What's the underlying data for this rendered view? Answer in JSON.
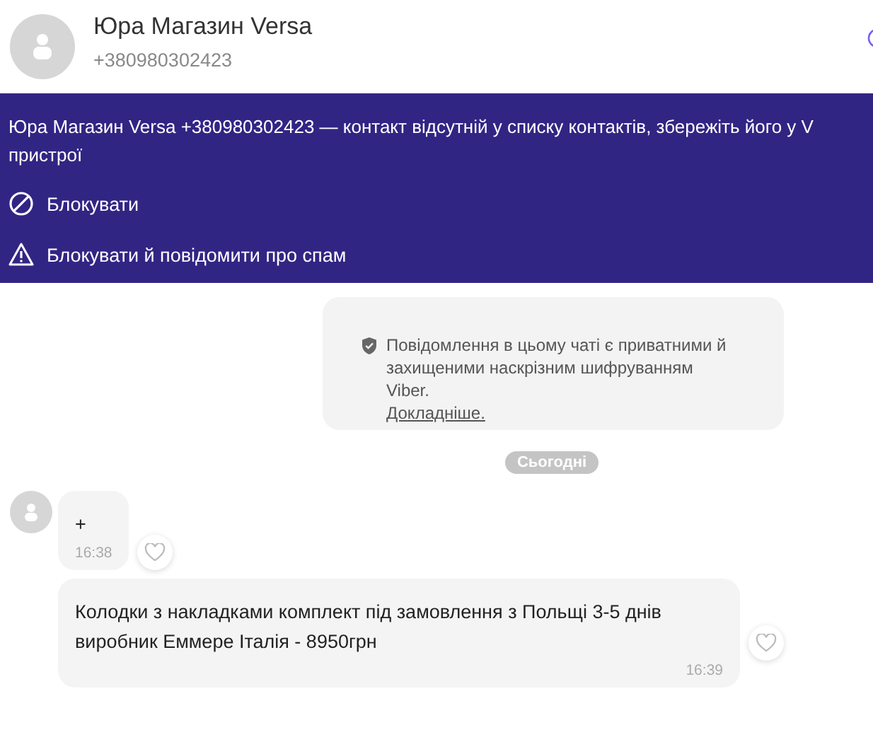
{
  "header": {
    "name": "Юра Магазин Versa",
    "phone": "+380980302423"
  },
  "banner": {
    "lines": [
      "Юра Магазин Versa +380980302423 — контакт відсутній у списку контактів, збережіть його у V",
      "пристрої"
    ],
    "actions": [
      {
        "kind": "block",
        "label": "Блокувати"
      },
      {
        "kind": "spam",
        "label": "Блокувати й повідомити про спам"
      }
    ]
  },
  "encryption_notice": {
    "text": "Повідомлення в цьому чаті є приватними й захищеними наскрізним шифруванням Viber.",
    "link": "Докладніше."
  },
  "date_divider": "Сьогодні",
  "messages": [
    {
      "text": "+",
      "time": "16:38",
      "avatar": true
    },
    {
      "text": "Колодки з накладками комплект під замовлення з Польщі 3-5 днів виробник Еммере Італія - 8950грн",
      "time": "16:39",
      "avatar": false
    }
  ]
}
